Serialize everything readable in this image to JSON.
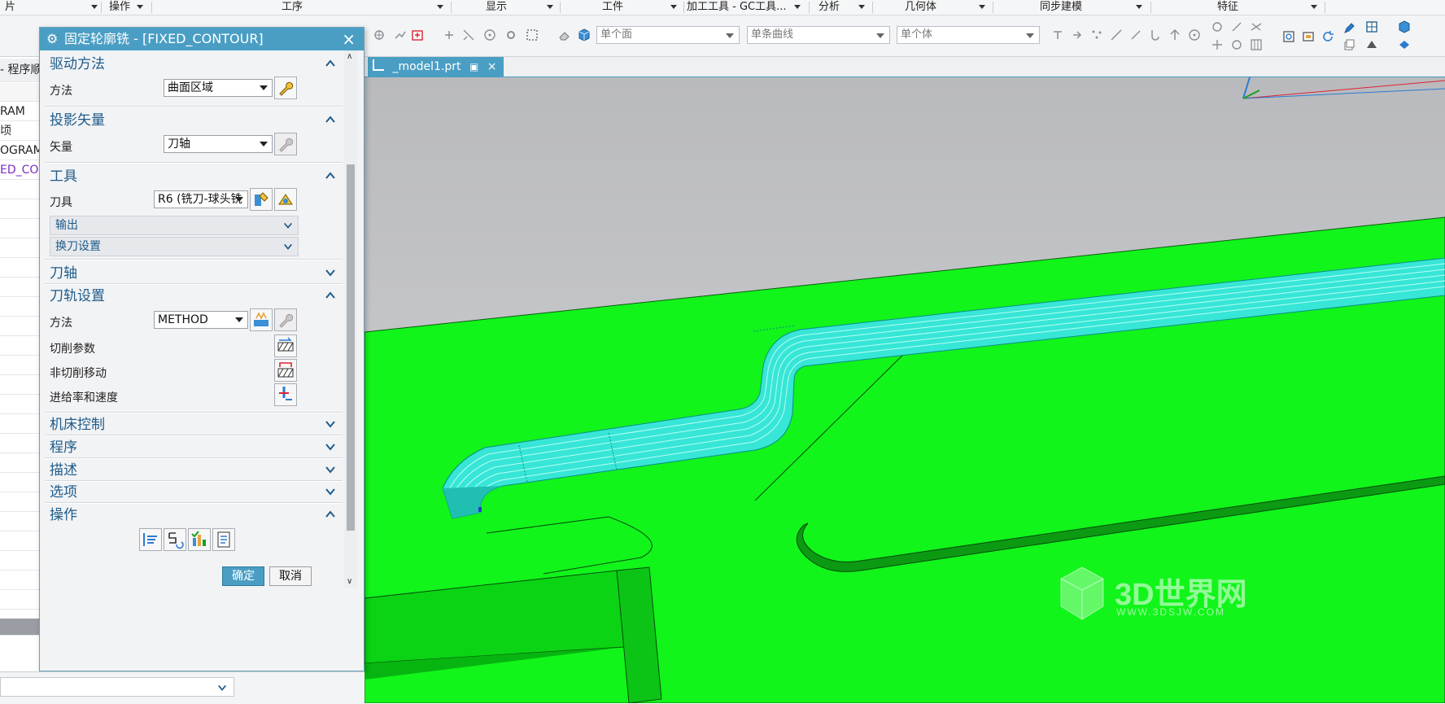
{
  "menu": {
    "items": [
      {
        "label": "片",
        "has_caret": true
      },
      {
        "label": "操作",
        "has_caret": true
      },
      {
        "label": "工序",
        "has_caret": true
      },
      {
        "label": "显示",
        "has_caret": true
      },
      {
        "label": "工件",
        "has_caret": true
      },
      {
        "label": "加工工具 - GC工具...",
        "has_caret": true
      },
      {
        "label": "分析",
        "has_caret": true
      },
      {
        "label": "几何体",
        "has_caret": true
      },
      {
        "label": "同步建模",
        "has_caret": true
      },
      {
        "label": "特征",
        "has_caret": true
      }
    ]
  },
  "toolbar": {
    "face_combo": "单个面",
    "curve_combo": "单条曲线",
    "body_combo": "单个体"
  },
  "navigator": {
    "header": "- 程序顺",
    "rows": [
      "RAM",
      "顷",
      "OGRAM",
      "ED_CO"
    ]
  },
  "tab": {
    "title": "_model1.prt"
  },
  "dialog": {
    "title": "固定轮廓铣 - [FIXED_CONTOUR]",
    "sections": {
      "drive_method": {
        "title": "驱动方法",
        "method_label": "方法",
        "method_value": "曲面区域"
      },
      "projection": {
        "title": "投影矢量",
        "vector_label": "矢量",
        "vector_value": "刀轴"
      },
      "tool": {
        "title": "工具",
        "tool_label": "刀具",
        "tool_value": "R6 (铣刀-球头铣",
        "output": "输出",
        "tool_change": "换刀设置"
      },
      "tool_axis": {
        "title": "刀轴"
      },
      "path_settings": {
        "title": "刀轨设置",
        "method_label": "方法",
        "method_value": "METHOD",
        "cut_params": "切削参数",
        "non_cut_moves": "非切削移动",
        "feeds_speeds": "进给率和速度"
      },
      "machine_control": {
        "title": "机床控制"
      },
      "program": {
        "title": "程序"
      },
      "description": {
        "title": "描述"
      },
      "options": {
        "title": "选项"
      },
      "actions": {
        "title": "操作"
      }
    },
    "ok": "确定",
    "cancel": "取消"
  },
  "watermark": {
    "brand": "3D世界网",
    "url": "WWW.3DSJW.COM"
  },
  "colors": {
    "accent": "#4a9ec4",
    "section_text": "#1d5b8a",
    "model_green": "#11f51a",
    "toolpath_cyan": "#37e6d6",
    "background_gray": "#c4c5c8"
  }
}
